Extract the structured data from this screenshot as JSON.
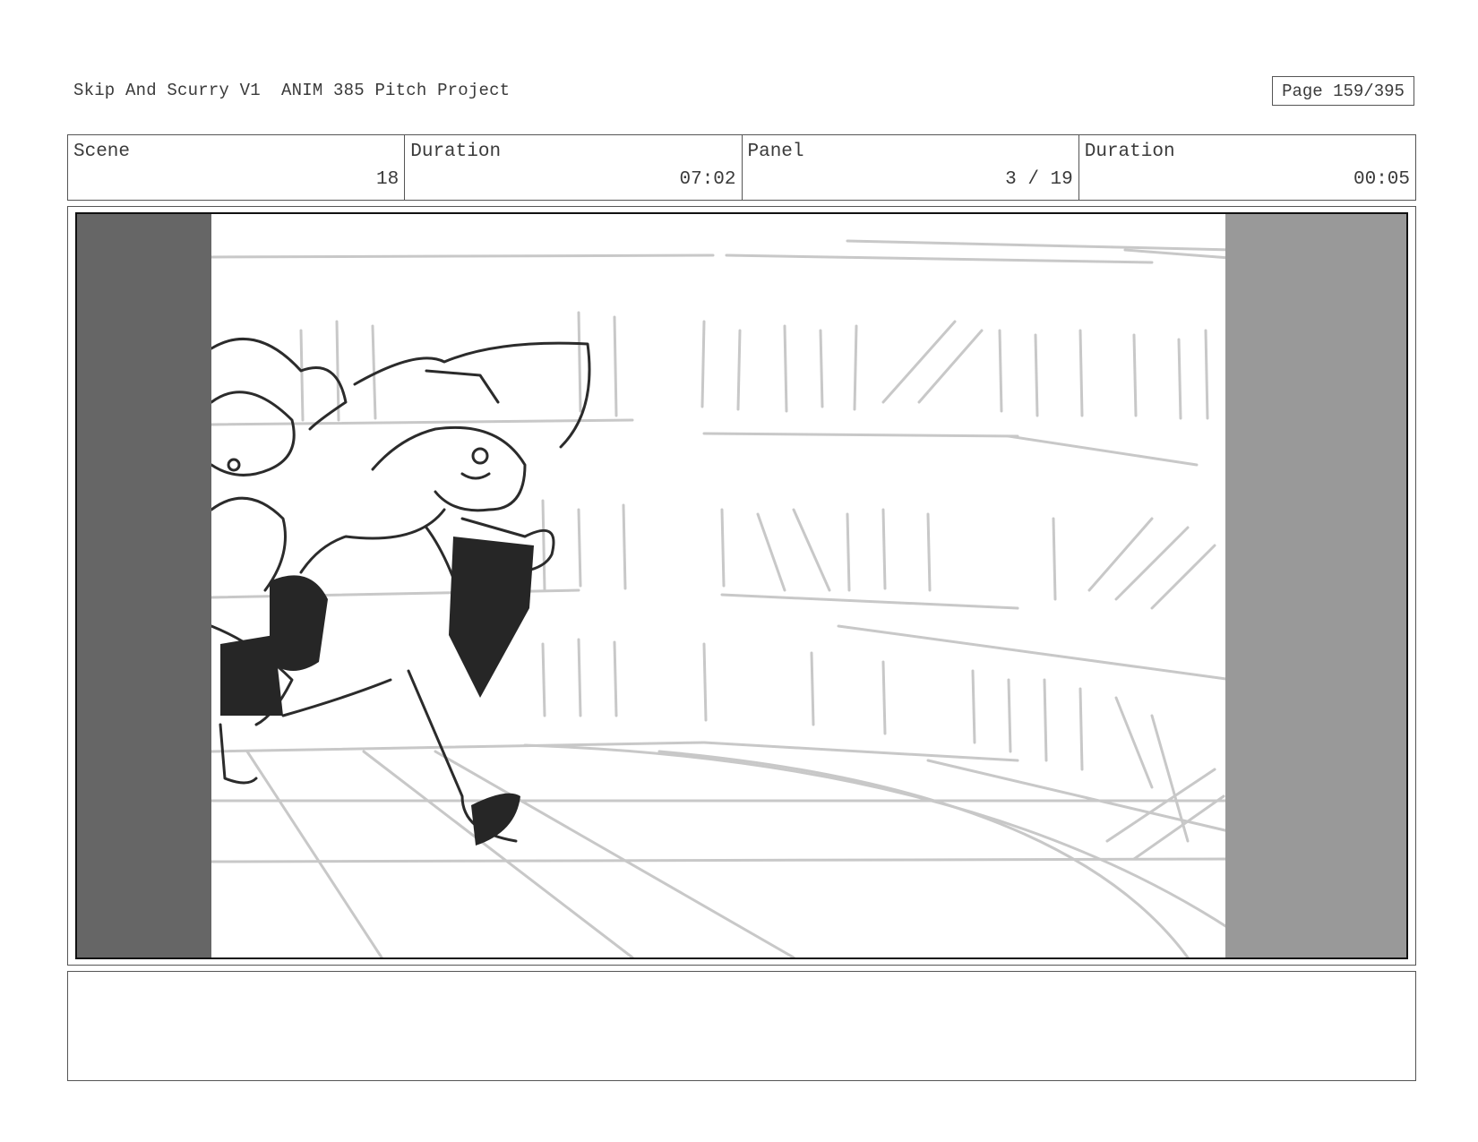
{
  "header": {
    "title": "Skip And Scurry V1  ANIM 385 Pitch Project",
    "page": "Page 159/395"
  },
  "info": [
    {
      "label": "Scene",
      "value": "18"
    },
    {
      "label": "Duration",
      "value": "07:02"
    },
    {
      "label": "Panel",
      "value": "3 / 19"
    },
    {
      "label": "Duration",
      "value": "00:05"
    }
  ],
  "notes": {
    "text": ""
  },
  "colors": {
    "letterbox_left": "#666666",
    "letterbox_right": "#999999",
    "sketch_light": "#c4c4c4",
    "sketch_dark": "#2a2a2a"
  }
}
